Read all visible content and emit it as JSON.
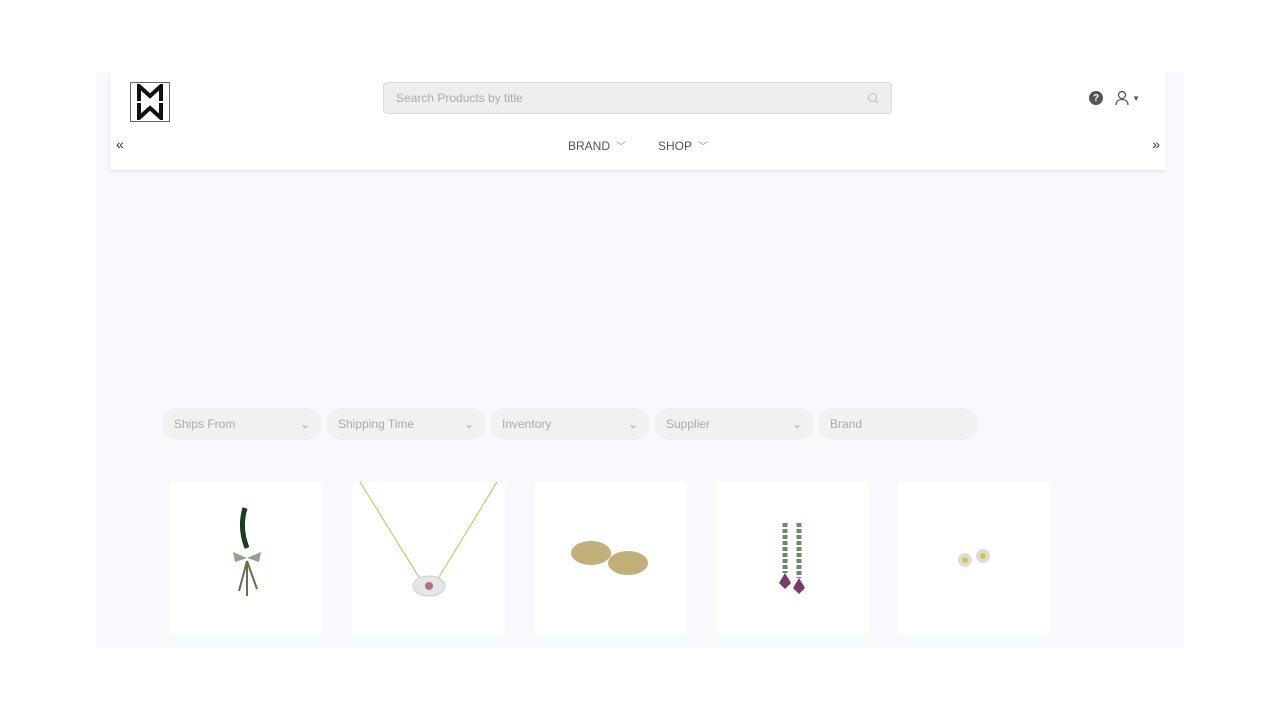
{
  "header": {
    "logo_text": "MW",
    "search_placeholder": "Search Products by title",
    "help_icon": "?"
  },
  "nav": [
    {
      "label": "BRAND"
    },
    {
      "label": "SHOP"
    }
  ],
  "filters": [
    {
      "label": "Ships From",
      "dropdown": true
    },
    {
      "label": "Shipping Time",
      "dropdown": true
    },
    {
      "label": "Inventory",
      "dropdown": true
    },
    {
      "label": "Supplier",
      "dropdown": true
    },
    {
      "label": "Brand",
      "dropdown": false
    }
  ],
  "products": [
    {
      "image": "green-bow-pendant"
    },
    {
      "image": "gold-necklace-pink-stone"
    },
    {
      "image": "gold-crystal-earrings"
    },
    {
      "image": "tourmaline-drop-earrings"
    },
    {
      "image": "yellow-flower-studs"
    }
  ]
}
